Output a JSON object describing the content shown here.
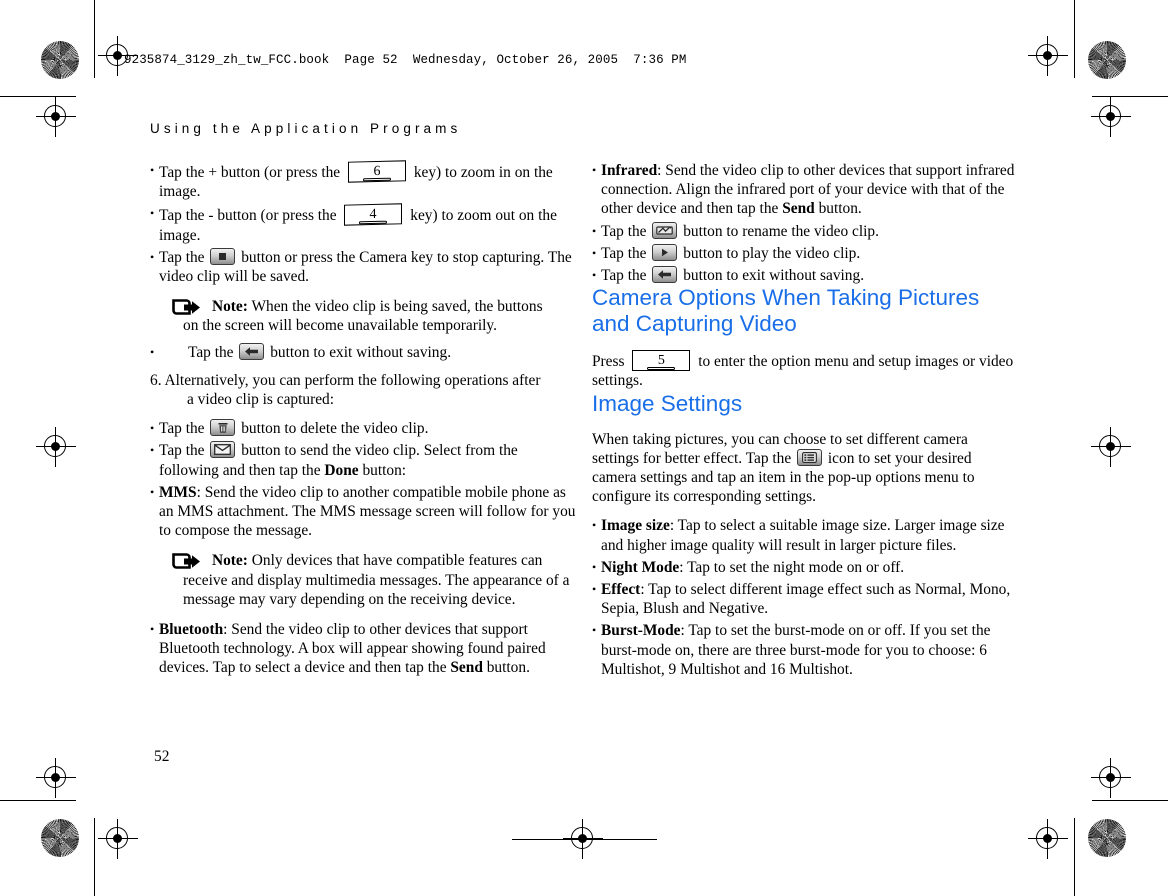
{
  "page": {
    "file_banner": "9235874_3129_zh_tw_FCC.book  Page 52  Wednesday, October 26, 2005  7:36 PM",
    "running_head": "Using the Application Programs",
    "folio": "52",
    "accent_color": "#1a6fe8"
  },
  "left_column": {
    "b1_a": "Tap the + button (or press the ",
    "b1_key": "6",
    "b1_b": " key) to zoom in on the image.",
    "b2_a": "Tap the - button (or press the ",
    "b2_key": "4",
    "b2_b": " key) to zoom out on the image.",
    "b3_a": "Tap the ",
    "b3_b": " button or press the Camera key to stop capturing. The video clip will be saved.",
    "note1_label": "Note:",
    "note1_text": " When the video clip is being saved, the buttons",
    "note1_text2": "on the screen will become unavailable temporarily.",
    "b4_a": "Tap the ",
    "b4_b": " button to exit without saving.",
    "step6_num": "6.",
    "step6_text": " Alternatively, you can perform the following operations after",
    "step6_text2": "a video clip is captured:",
    "b5_a": "Tap the ",
    "b5_b": " button to delete the video clip.",
    "b6_a": "Tap the ",
    "b6_b": " button to send the video clip. Select from the following and then tap the ",
    "b6_bold": "Done",
    "b6_c": " button:",
    "mms_label": "MMS",
    "mms_text": ": Send the video clip to another compatible mobile phone as an MMS attachment. The MMS message screen will follow for you to compose the message.",
    "note2_label": "Note:",
    "note2_text": " Only devices that have compatible features can",
    "note2_text2": "receive and display multimedia messages. The appearance of a message may vary depending on the receiving device.",
    "bt_label": "Bluetooth",
    "bt_text": ": Send the video clip to other devices that support Bluetooth technology. A box will appear showing found paired devices. Tap to select a device and then tap the ",
    "bt_bold": "Send",
    "bt_text2": " button."
  },
  "right_column": {
    "ir_label": "Infrared",
    "ir_text": ": Send the video clip to other devices that support infrared connection. Align the infrared port of your device with that of the other device and then tap the ",
    "ir_bold": "Send",
    "ir_text2": " button.",
    "r1_a": "Tap the ",
    "r1_b": " button to rename the video clip.",
    "r2_a": "Tap the ",
    "r2_b": " button to play the video clip.",
    "r3_a": "Tap the ",
    "r3_b": " button to exit without saving.",
    "heading1": "Camera Options When Taking Pictures and Capturing Video",
    "press_a": "Press ",
    "press_key": "5",
    "press_b": " to enter the option menu and setup images or video settings.",
    "heading2": "Image Settings",
    "intro_a": "When taking pictures, you can choose to set different camera settings for better effect. Tap the ",
    "intro_b": " icon to set your desired camera settings and tap an item in the pop-up options menu to configure its corresponding settings.",
    "imgsize_label": "Image size",
    "imgsize_text": ": Tap to select a suitable image size. Larger image size and higher image quality will result in larger picture files.",
    "night_label": "Night Mode",
    "night_text": ": Tap to set the night mode on or off.",
    "effect_label": "Effect",
    "effect_text": ": Tap to select different image effect such as Normal, Mono, Sepia, Blush and Negative.",
    "burst_label": "Burst-Mode",
    "burst_text": ": Tap to set the burst-mode on or off. If you set the burst-mode on, there are three burst-mode for you to choose: 6 Multishot, 9 Multishot and 16 Multishot."
  },
  "icons": {
    "stop_button": "stop-capture-icon",
    "back_button": "back-arrow-icon",
    "delete_button": "trash-icon",
    "send_button": "envelope-icon",
    "rename_button": "rename-icon",
    "play_button": "play-icon",
    "options_button": "list-menu-icon",
    "note_marker": "note-pointer-icon"
  }
}
